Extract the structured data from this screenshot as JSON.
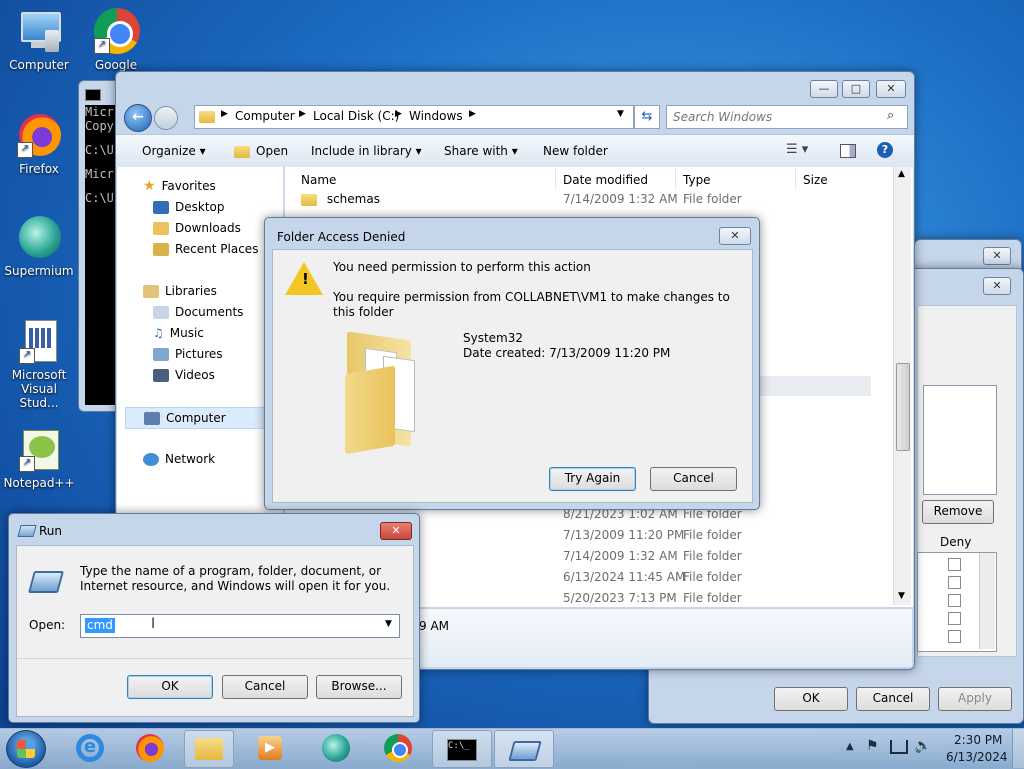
{
  "desktop": {
    "icons": [
      {
        "label": "Computer"
      },
      {
        "label": "Google"
      },
      {
        "label": "Firefox"
      },
      {
        "label": "Supermium"
      },
      {
        "label": "Microsoft Visual Stud..."
      },
      {
        "label": "Notepad++"
      }
    ]
  },
  "cmd": {
    "lines": [
      "Micr",
      "Copy",
      "C:\\U",
      "Micr",
      "C:\\U"
    ]
  },
  "explorer": {
    "breadcrumb": [
      "Computer",
      "Local Disk (C:)",
      "Windows"
    ],
    "search_placeholder": "Search Windows",
    "toolbar": {
      "organize": "Organize",
      "open": "Open",
      "include": "Include in library",
      "share": "Share with",
      "new_folder": "New folder"
    },
    "nav": {
      "favorites": "Favorites",
      "desktop": "Desktop",
      "downloads": "Downloads",
      "recent": "Recent Places",
      "libraries": "Libraries",
      "documents": "Documents",
      "music": "Music",
      "pictures": "Pictures",
      "videos": "Videos",
      "computer": "Computer",
      "network": "Network"
    },
    "columns": {
      "name": "Name",
      "date": "Date modified",
      "type": "Type",
      "size": "Size"
    },
    "rows_top": [
      {
        "name": "schemas",
        "date": "7/14/2009 1:32 AM",
        "type": "File folder"
      }
    ],
    "rows_bottom": [
      {
        "date": "8/21/2023 1:02 AM",
        "type": "File folder"
      },
      {
        "date": "7/13/2009 11:20 PM",
        "type": "File folder"
      },
      {
        "date": "7/14/2009 1:32 AM",
        "type": "File folder"
      },
      {
        "date": "6/13/2024 11:45 AM",
        "type": "File folder"
      },
      {
        "date": "5/20/2023 7:13 PM",
        "type": "File folder"
      }
    ],
    "status_fragment": "9 AM"
  },
  "security": {
    "remove": "Remove",
    "deny": "Deny",
    "ok": "OK",
    "cancel": "Cancel",
    "apply": "Apply"
  },
  "dialog": {
    "title": "Folder Access Denied",
    "heading": "You need permission to perform this action",
    "message": "You require permission from COLLABNET\\VM1 to make changes to this folder",
    "item_name": "System32",
    "item_date": "Date created: 7/13/2009 11:20 PM",
    "try_again": "Try Again",
    "cancel": "Cancel"
  },
  "run": {
    "title": "Run",
    "description": "Type the name of a program, folder, document, or Internet resource, and Windows will open it for you.",
    "open_label": "Open:",
    "value": "cmd",
    "ok": "OK",
    "cancel": "Cancel",
    "browse": "Browse..."
  },
  "taskbar": {
    "time": "2:30 PM",
    "date": "6/13/2024"
  },
  "colors": {
    "accent": "#1f5fb3",
    "close": "#c9463d",
    "selection": "#3399ff"
  }
}
